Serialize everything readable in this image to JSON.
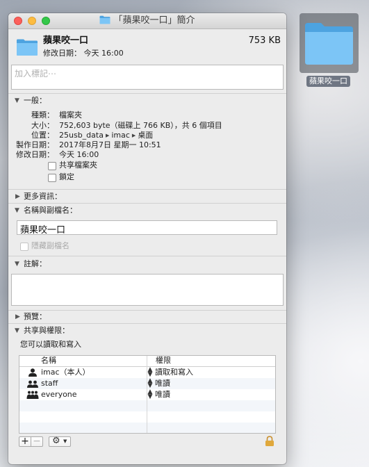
{
  "desktop": {
    "folder_label": "蘋果咬一口",
    "folder_icon": "folder-icon"
  },
  "window": {
    "title": "「蘋果咬一口」簡介",
    "title_icon": "folder-icon"
  },
  "header": {
    "name": "蘋果咬一口",
    "size": "753 KB",
    "modified": "修改日期： 今天 16:00"
  },
  "tags": {
    "placeholder": "加入標記⋯"
  },
  "general": {
    "title": "一般：",
    "rows": [
      {
        "label": "種類：",
        "value": "檔案夾"
      },
      {
        "label": "大小：",
        "value": "752,603 byte（磁碟上 766 KB），共 6 個項目"
      },
      {
        "label": "位置：",
        "path": [
          "25usb_data",
          "imac",
          "桌面"
        ]
      },
      {
        "label": "製作日期：",
        "value": "2017年8月7日 星期一 10:51"
      },
      {
        "label": "修改日期：",
        "value": "今天 16:00"
      }
    ],
    "shared_folder": "共享檔案夾",
    "locked": "鎖定"
  },
  "more_info": {
    "title": "更多資訊："
  },
  "name_ext": {
    "title": "名稱與副檔名：",
    "value": "蘋果咬一口",
    "hide_ext": "隱藏副檔名"
  },
  "comments": {
    "title": "註解："
  },
  "preview": {
    "title": "預覽："
  },
  "sharing": {
    "title": "共享與權限：",
    "summary": "您可以讀取和寫入",
    "col_name": "名稱",
    "col_priv": "權限",
    "rows": [
      {
        "name": "imac（本人）",
        "privilege": "讀取和寫入",
        "icon": "user-icon"
      },
      {
        "name": "staff",
        "privilege": "唯讀",
        "icon": "group-icon"
      },
      {
        "name": "everyone",
        "privilege": "唯讀",
        "icon": "everyone-icon"
      }
    ],
    "add_symbol": "+",
    "remove_symbol": "−"
  },
  "colors": {
    "folder_blue": "#5fb6ee",
    "lock_gold": "#e0a83b"
  }
}
